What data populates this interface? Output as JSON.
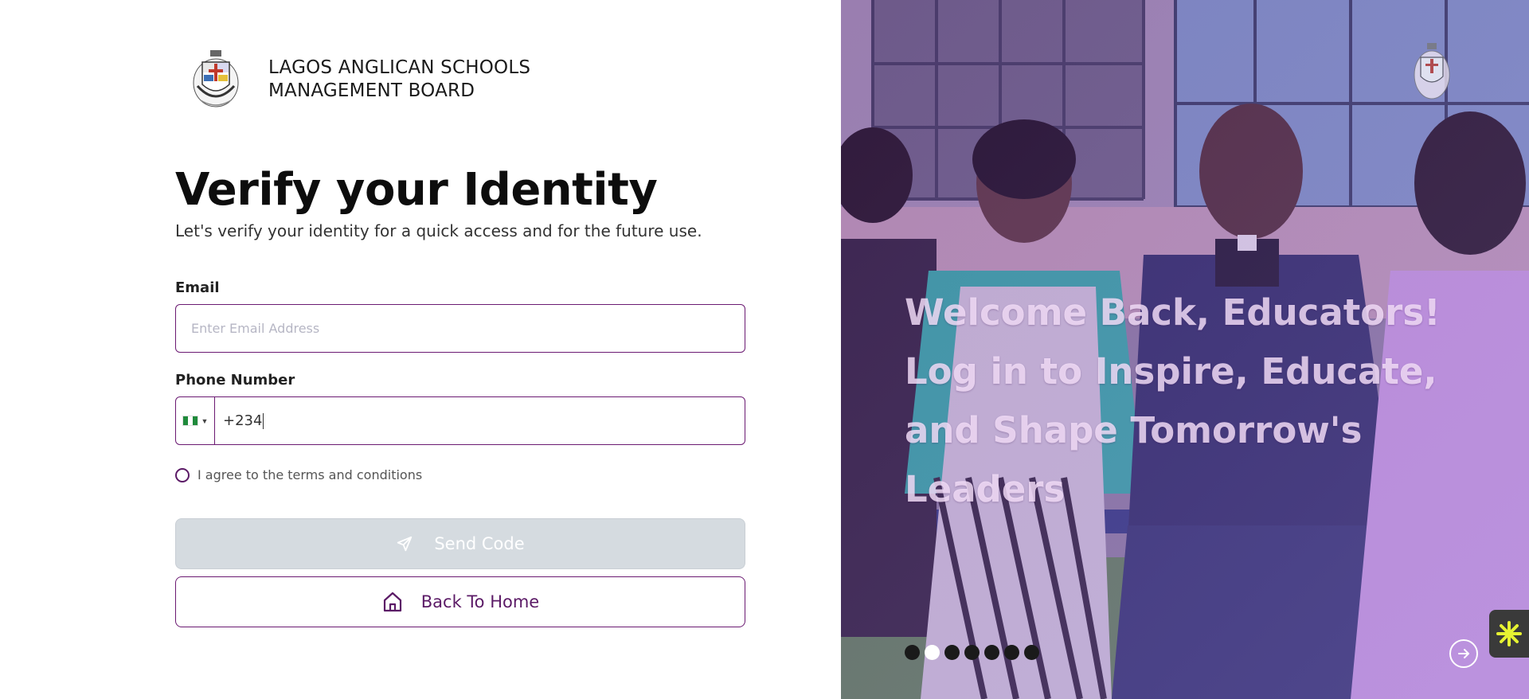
{
  "brand": {
    "line1": "LAGOS ANGLICAN SCHOOLS",
    "line2": "MANAGEMENT BOARD",
    "logo_icon": "crest-logo-icon"
  },
  "page": {
    "title": "Verify your Identity",
    "subtitle": "Let's verify your identity for a quick access and for the future use."
  },
  "form": {
    "email_label": "Email",
    "email_placeholder": "Enter Email Address",
    "email_value": "",
    "phone_label": "Phone Number",
    "phone_country_flag": "nigeria-flag-icon",
    "phone_value": "+234",
    "terms_label": "I agree to the terms and conditions",
    "terms_checked": false
  },
  "buttons": {
    "send_code": "Send Code",
    "send_code_icon": "send-icon",
    "back_home": "Back To Home",
    "back_home_icon": "home-icon"
  },
  "hero": {
    "headline": "Welcome Back, Educators! Log in to Inspire, Educate, and Shape Tomorrow's Leaders",
    "carousel_slide_count": 7,
    "carousel_active_index": 1,
    "next_icon": "arrow-right-circle-icon"
  },
  "colors": {
    "accent": "#6b1a72",
    "disabled_button": "#d5dbe0",
    "hero_text": "#f5e1fa",
    "widget_bg": "#3a3a3a",
    "widget_icon": "#e6f232"
  }
}
